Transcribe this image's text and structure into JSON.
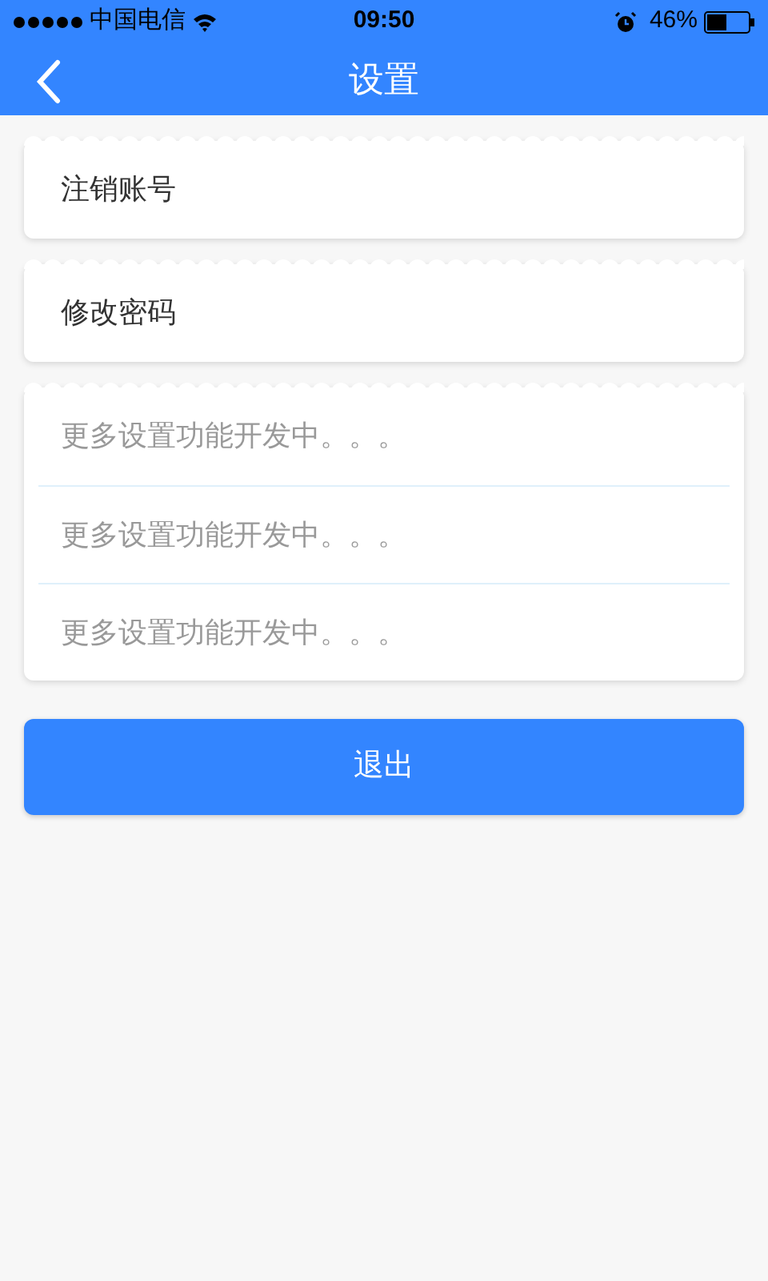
{
  "status_bar": {
    "carrier": "中国电信",
    "time": "09:50",
    "battery": "46%"
  },
  "nav_bar": {
    "title": "设置"
  },
  "groups": [
    {
      "items": [
        {
          "label": "注销账号",
          "disabled": false
        }
      ]
    },
    {
      "items": [
        {
          "label": "修改密码",
          "disabled": false
        }
      ]
    },
    {
      "items": [
        {
          "label": "更多设置功能开发中。。。",
          "disabled": true
        },
        {
          "label": "更多设置功能开发中。。。",
          "disabled": true
        },
        {
          "label": "更多设置功能开发中。。。",
          "disabled": true
        }
      ]
    }
  ],
  "logout_button": {
    "label": "退出"
  }
}
